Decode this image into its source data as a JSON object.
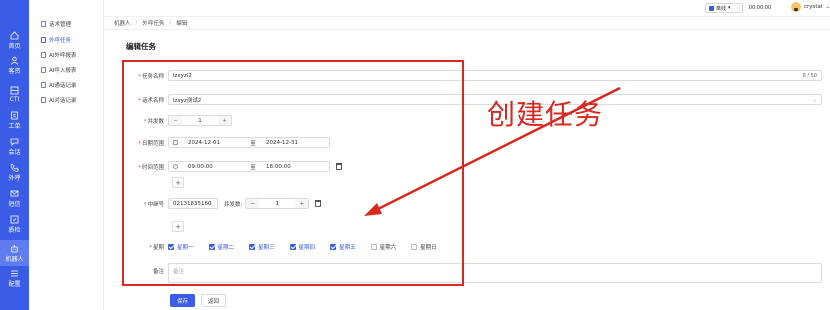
{
  "rail": [
    {
      "label": "首页",
      "icon": "home-icon"
    },
    {
      "label": "客资",
      "icon": "users-icon"
    },
    {
      "label": "CTI",
      "icon": "cti-icon"
    },
    {
      "label": "工单",
      "icon": "ticket-icon"
    },
    {
      "label": "会话",
      "icon": "chat-icon"
    },
    {
      "label": "外呼",
      "icon": "phone-icon"
    },
    {
      "label": "短信",
      "icon": "sms-icon"
    },
    {
      "label": "质检",
      "icon": "inspect-icon"
    },
    {
      "label": "机器人",
      "icon": "robot-icon",
      "active": true
    },
    {
      "label": "配置",
      "icon": "settings-icon"
    }
  ],
  "submenu": [
    {
      "label": "话术管理"
    },
    {
      "label": "外呼任务",
      "active": true
    },
    {
      "label": "AI外呼报表"
    },
    {
      "label": "AI呼入报表"
    },
    {
      "label": "AI通话记录"
    },
    {
      "label": "AI对话记录"
    }
  ],
  "topbar": {
    "status": "离线",
    "timer": "00:00:00",
    "username": "crystal"
  },
  "breadcrumb": [
    "机器人",
    "外呼任务",
    "编辑"
  ],
  "page_title": "编辑任务",
  "form": {
    "task_name_label": "任务名称",
    "task_name_value": "lzxyzl2",
    "task_name_counter": "6 / 50",
    "script_label": "话术名称",
    "script_value": "lzxyz测试2",
    "concurrency_label": "并发数",
    "concurrency_value": "1",
    "date_label": "日期范围",
    "date_start": "2024-12-01",
    "date_to": "至",
    "date_end": "2024-12-31",
    "time_label": "时间范围",
    "time_start": "09:00:00",
    "time_to": "至",
    "time_end": "18:00:00",
    "relay_label": "中继号",
    "relay_value": "02131835160",
    "relay_concurrency_label": "并发数:",
    "relay_concurrency_value": "1",
    "weekday_label": "星期",
    "weekdays": [
      {
        "label": "星期一",
        "checked": true
      },
      {
        "label": "星期二",
        "checked": true
      },
      {
        "label": "星期三",
        "checked": true
      },
      {
        "label": "星期四",
        "checked": true
      },
      {
        "label": "星期五",
        "checked": true
      },
      {
        "label": "星期六",
        "checked": false
      },
      {
        "label": "星期日",
        "checked": false
      }
    ],
    "note_label": "备注",
    "note_placeholder": "备注"
  },
  "actions": {
    "save": "保存",
    "back": "返回"
  },
  "annotation": {
    "text": "创建任务",
    "color": "#d8281f"
  },
  "colors": {
    "accent": "#3b5ce6",
    "required": "#e34040"
  }
}
